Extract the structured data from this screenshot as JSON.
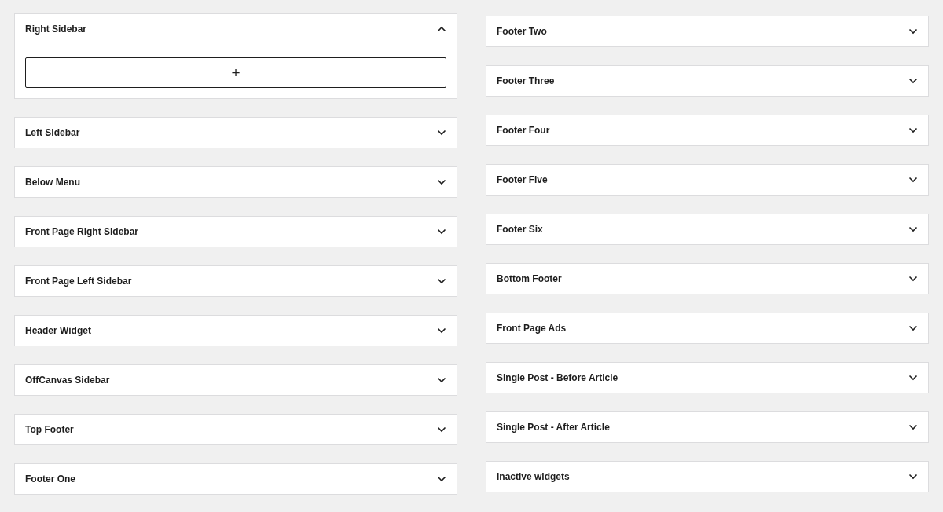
{
  "columns": [
    {
      "areas": [
        {
          "title": "Right Sidebar",
          "expanded": true,
          "add_block": "+"
        },
        {
          "title": "Left Sidebar",
          "expanded": false
        },
        {
          "title": "Below Menu",
          "expanded": false
        },
        {
          "title": "Front Page Right Sidebar",
          "expanded": false
        },
        {
          "title": "Front Page Left Sidebar",
          "expanded": false
        },
        {
          "title": "Header Widget",
          "expanded": false
        },
        {
          "title": "OffCanvas Sidebar",
          "expanded": false
        },
        {
          "title": "Top Footer",
          "expanded": false
        },
        {
          "title": "Footer One",
          "expanded": false
        }
      ]
    },
    {
      "areas": [
        {
          "title": "Footer Two",
          "expanded": false
        },
        {
          "title": "Footer Three",
          "expanded": false
        },
        {
          "title": "Footer Four",
          "expanded": false
        },
        {
          "title": "Footer Five",
          "expanded": false
        },
        {
          "title": "Footer Six",
          "expanded": false
        },
        {
          "title": "Bottom Footer",
          "expanded": false
        },
        {
          "title": "Front Page Ads",
          "expanded": false
        },
        {
          "title": "Single Post - Before Article",
          "expanded": false
        },
        {
          "title": "Single Post - After Article",
          "expanded": false
        },
        {
          "title": "Inactive widgets",
          "expanded": false
        }
      ]
    }
  ]
}
